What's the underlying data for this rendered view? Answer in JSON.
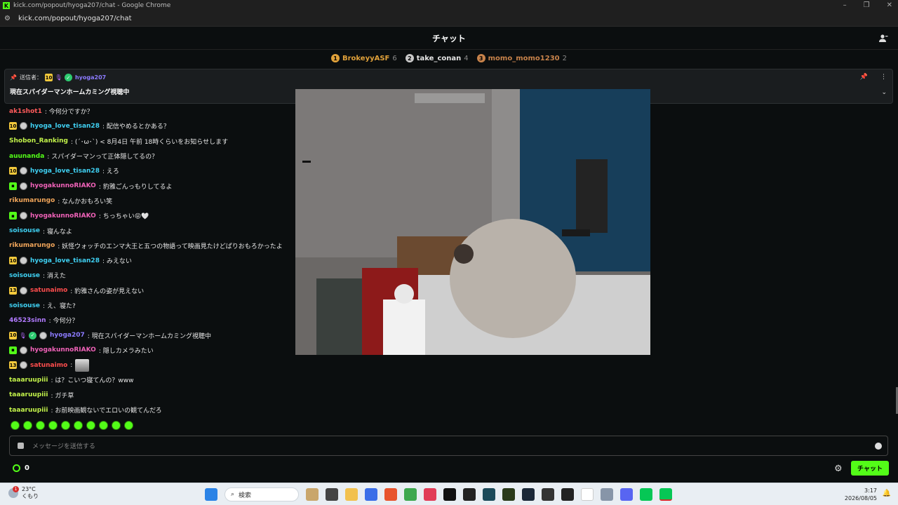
{
  "window": {
    "title": "kick.com/popout/hyoga207/chat - Google Chrome",
    "url": "kick.com/popout/hyoga207/chat"
  },
  "chat": {
    "title": "チャット",
    "leaderboard": [
      {
        "rank": "1",
        "name": "BrokeyyASF",
        "count": "6",
        "color": "#e0a13a"
      },
      {
        "rank": "2",
        "name": "take_conan",
        "count": "4",
        "color": "#c9c9c9"
      },
      {
        "rank": "3",
        "name": "momo_momo1230",
        "count": "2",
        "color": "#c8834b"
      }
    ],
    "pinned": {
      "label": "送信者：",
      "sub_level": "10",
      "user": "hyoga207",
      "message": "現在スパイダーマンホームカミング視聴中"
    },
    "messages": [
      {
        "user": "ak1shot1",
        "color": "#ff5b5b",
        "text": ": 今何分ですか？"
      },
      {
        "sub": "10",
        "user": "hyoga_love_tisan28",
        "color": "#3fd0f2",
        "text": ": 配信やめるとかある？"
      },
      {
        "user": "Shobon_Ranking",
        "color": "#c2f24a",
        "text": ": (´･ω･`) < 8月4日 午前 18時くらいをお知らせします"
      },
      {
        "user": "auunanda",
        "color": "#53fc18",
        "text": ": スパイダーマンって正体隠してるの？"
      },
      {
        "sub": "10",
        "user": "hyoga_love_tisan28",
        "color": "#3fd0f2",
        "text": ": えろ"
      },
      {
        "gift": true,
        "user": "hyogakunnoRIAKO",
        "color": "#f062b8",
        "text": ": 豹雅ごんっもりしてるよ"
      },
      {
        "user": "rikumarungo",
        "color": "#f2a65a",
        "text": ": なんかおもろい笑"
      },
      {
        "gift": true,
        "user": "hyogakunnoRIAKO",
        "color": "#f062b8",
        "text": ": ちっちゃい😝🤍"
      },
      {
        "user": "soisouse",
        "color": "#3fd0f2",
        "text": ": 寝んなよ"
      },
      {
        "user": "rikumarungo",
        "color": "#f2a65a",
        "text": ": 妖怪ウォッチのエンマ大王と五つの物語って映画見たけどぱりおもろかったよ"
      },
      {
        "sub": "10",
        "user": "hyoga_love_tisan28",
        "color": "#3fd0f2",
        "text": ": みえない"
      },
      {
        "user": "soisouse",
        "color": "#3fd0f2",
        "text": ": 消えた"
      },
      {
        "sub": "13",
        "user": "satunaimo",
        "color": "#ff4d4d",
        "text": ": 豹雅さんの姿が見えない"
      },
      {
        "user": "soisouse",
        "color": "#3fd0f2",
        "text": ": え、寝た?"
      },
      {
        "user": "46523sinn",
        "color": "#b27bff",
        "text": ": 今何分？"
      },
      {
        "sub": "10",
        "mic": true,
        "verified": true,
        "user": "hyoga207",
        "color": "#8c7bff",
        "text": ": 現在スパイダーマンホームカミング視聴中"
      },
      {
        "gift": true,
        "user": "hyogakunnoRIAKO",
        "color": "#f062b8",
        "text": ": 隠しカメラみたい"
      },
      {
        "sub": "13",
        "user": "satunaimo",
        "color": "#ff4d4d",
        "text": ":",
        "emote": true
      },
      {
        "user": "taaaruupiii",
        "color": "#c2f24a",
        "text": ": は？こいつ寝てんの？www"
      },
      {
        "user": "taaaruupiii",
        "color": "#c2f24a",
        "text": ": ガチ草"
      },
      {
        "user": "taaaruupiii",
        "color": "#c2f24a",
        "text": ": お前映画観ないでエロいの観てんだろ"
      }
    ],
    "input_placeholder": "メッセージを送信する",
    "points": "0",
    "send_label": "チャット"
  },
  "taskbar": {
    "temperature": "23°C",
    "weather": "くもり",
    "weather_badge": "1",
    "search_placeholder": "検索",
    "time": "3:17",
    "date": "2026/08/05"
  },
  "colors": {
    "accent": "#53fc18",
    "background": "#0b0e0f"
  }
}
